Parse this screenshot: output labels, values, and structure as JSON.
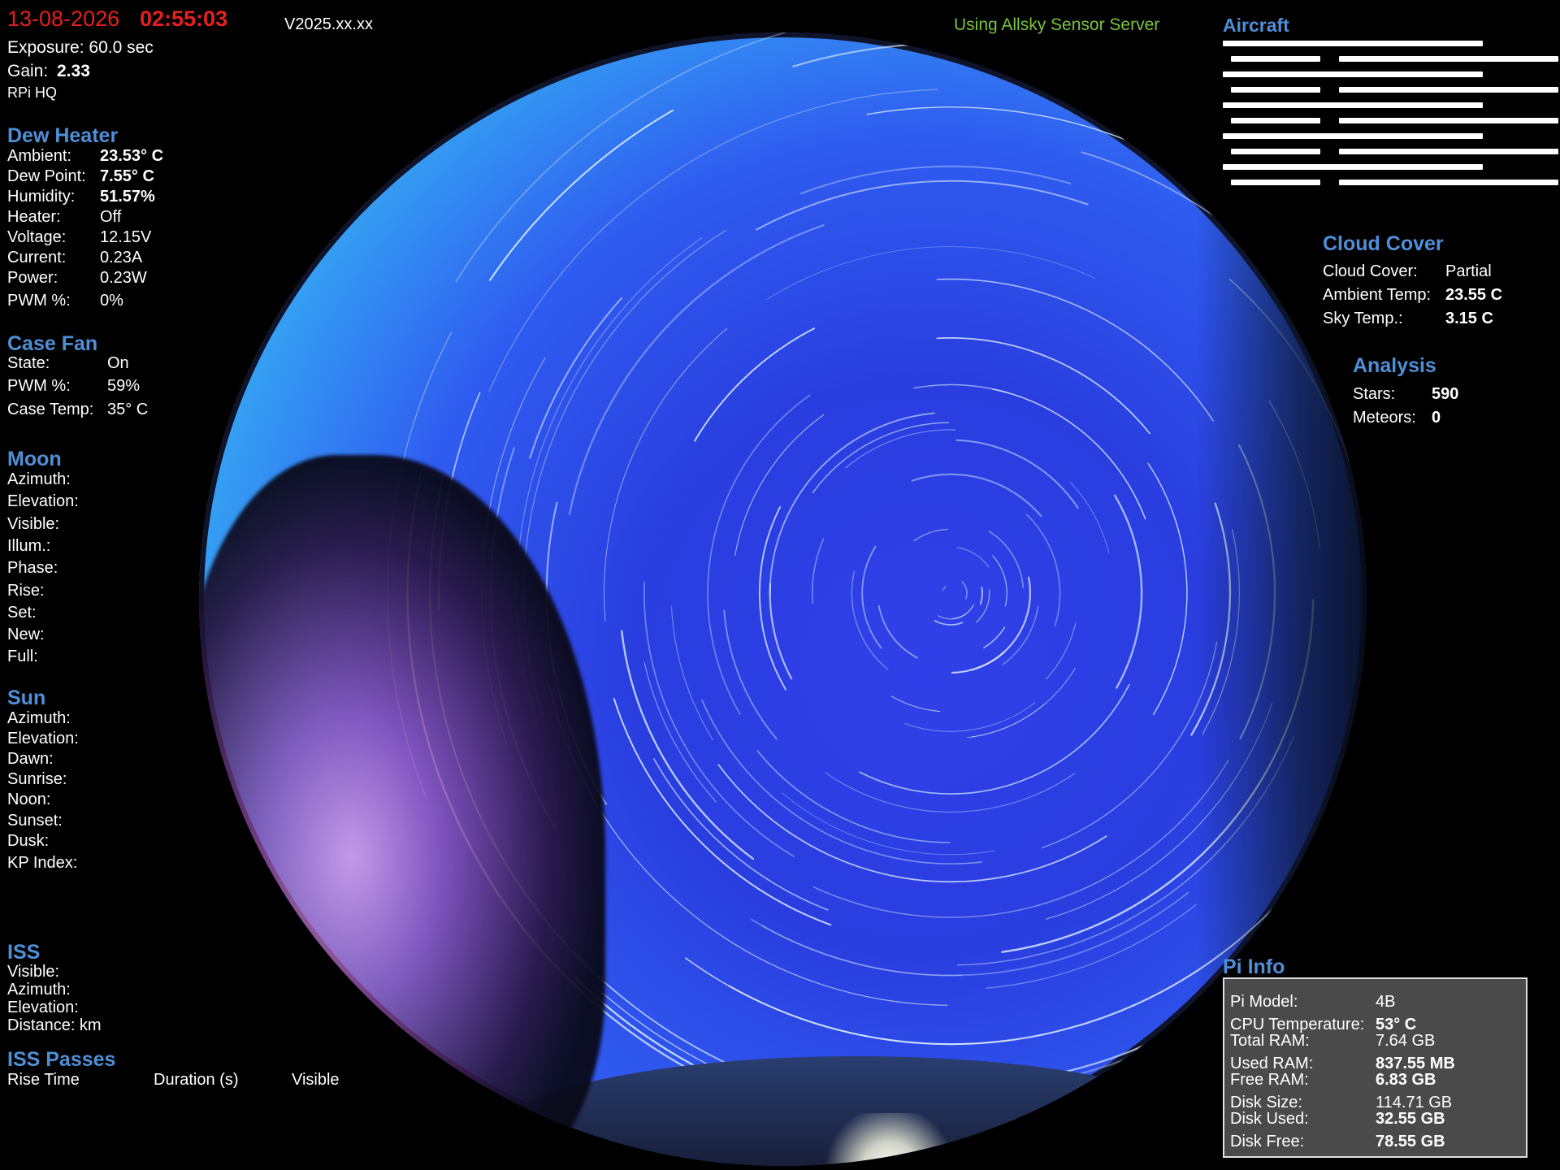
{
  "header": {
    "date": "13-08-2026",
    "time": "02:55:03",
    "version": "V2025.xx.xx",
    "server_status": "Using Allsky Sensor Server"
  },
  "camera": {
    "exposure": "Exposure: 60.0 sec",
    "gain_label": "Gain:",
    "gain_value": "2.33",
    "model": "RPi  HQ"
  },
  "dew_heater": {
    "title": "Dew Heater",
    "rows": [
      {
        "label": "Ambient:",
        "value": "23.53° C"
      },
      {
        "label": "Dew Point:",
        "value": "7.55° C"
      },
      {
        "label": "Humidity:",
        "value": "51.57%"
      },
      {
        "label": "Heater:",
        "value": "Off"
      },
      {
        "label": "Voltage:",
        "value": "12.15V"
      },
      {
        "label": "Current:",
        "value": "0.23A"
      },
      {
        "label": "Power:",
        "value": "0.23W"
      },
      {
        "label": "PWM %:",
        "value": "0%"
      }
    ]
  },
  "case_fan": {
    "title": "Case Fan",
    "rows": [
      {
        "label": "State:",
        "value": "On"
      },
      {
        "label": "PWM %:",
        "value": "59%"
      },
      {
        "label": "Case Temp:",
        "value": "35° C"
      }
    ]
  },
  "moon": {
    "title": "Moon",
    "rows": [
      "Azimuth:",
      "Elevation:",
      "Visible:",
      "Illum.:",
      "Phase:",
      "Rise:",
      "Set:",
      "New:",
      "Full:"
    ]
  },
  "sun": {
    "title": "Sun",
    "rows": [
      "Azimuth:",
      "Elevation:",
      "Dawn:",
      "Sunrise:",
      "Noon:",
      "Sunset:",
      "Dusk:",
      "KP Index:"
    ]
  },
  "iss": {
    "title": "ISS",
    "rows": [
      "Visible:",
      "Azimuth:",
      "Elevation:",
      "Distance:  km"
    ]
  },
  "iss_passes": {
    "title": "ISS Passes",
    "columns": [
      "Rise Time",
      "Duration (s)",
      "Visible"
    ]
  },
  "aircraft": {
    "title": "Aircraft"
  },
  "cloud_cover": {
    "title": "Cloud Cover",
    "rows": [
      {
        "label": "Cloud Cover:",
        "value": "Partial"
      },
      {
        "label": "Ambient Temp:",
        "value": "23.55 C"
      },
      {
        "label": "Sky Temp.:",
        "value": "3.15 C"
      }
    ]
  },
  "analysis": {
    "title": "Analysis",
    "rows": [
      {
        "label": "Stars:",
        "value": "590"
      },
      {
        "label": "Meteors:",
        "value": "0"
      }
    ]
  },
  "pi_info": {
    "title": "Pi Info",
    "rows": [
      {
        "label": "Pi Model:",
        "value": "4B"
      },
      {
        "label": "CPU Temperature:",
        "value": "53° C"
      },
      {
        "label": "Total RAM:",
        "value": "7.64 GB"
      },
      {
        "label": "Used RAM:",
        "value": "837.55 MB"
      },
      {
        "label": "Free RAM:",
        "value": "6.83 GB"
      },
      {
        "label": "Disk Size:",
        "value": "114.71 GB"
      },
      {
        "label": "Disk Used:",
        "value": "32.55 GB"
      },
      {
        "label": "Disk Free:",
        "value": "78.55 GB"
      }
    ]
  },
  "colors": {
    "title_blue": "#4f8fd8",
    "date_red": "#e62020",
    "server_green": "#79c43c",
    "sky_center": "#2a3ee0",
    "sky_edge": "#4dd7ff"
  }
}
